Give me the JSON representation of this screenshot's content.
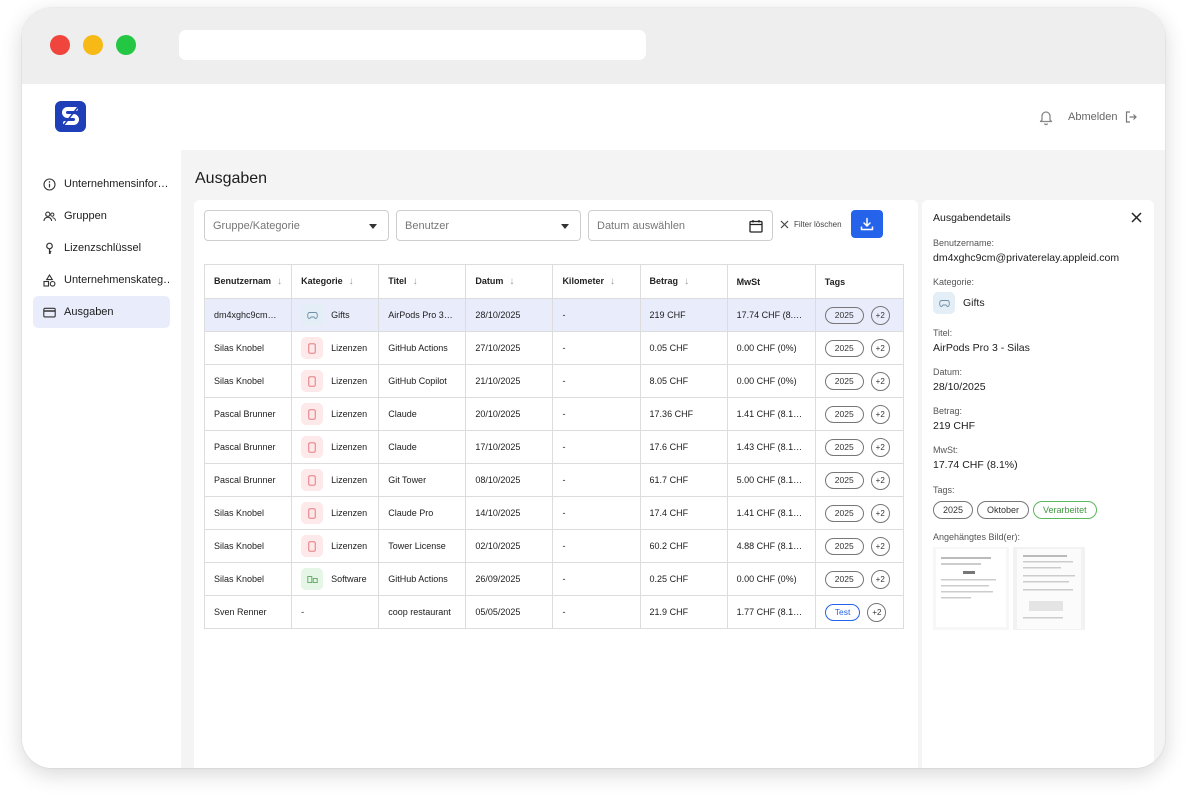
{
  "header": {
    "logout_label": "Abmelden"
  },
  "sidebar": {
    "items": [
      {
        "label": "Unternehmensinfor…",
        "icon": "info-icon"
      },
      {
        "label": "Gruppen",
        "icon": "users-icon"
      },
      {
        "label": "Lizenzschlüssel",
        "icon": "key-icon"
      },
      {
        "label": "Unternehmenskateg…",
        "icon": "shapes-icon"
      },
      {
        "label": "Ausgaben",
        "icon": "card-icon",
        "active": true
      }
    ]
  },
  "main": {
    "title": "Ausgaben",
    "filters": {
      "group_placeholder": "Gruppe/Kategorie",
      "user_placeholder": "Benutzer",
      "date_placeholder": "Datum auswählen",
      "clear_label": "Filter löschen"
    },
    "table": {
      "columns": [
        "Benutzernam",
        "Kategorie",
        "Titel",
        "Datum",
        "Kilometer",
        "Betrag",
        "MwSt",
        "Tags"
      ],
      "rows": [
        {
          "user": "dm4xghc9cm…",
          "category": "Gifts",
          "cat_type": "gifts",
          "title": "AirPods Pro 3…",
          "date": "28/10/2025",
          "km": "-",
          "amount": "219 CHF",
          "vat": "17.74 CHF (8.…",
          "tag": "2025",
          "more": "+2",
          "selected": true
        },
        {
          "user": "Silas Knobel",
          "category": "Lizenzen",
          "cat_type": "lic",
          "title": "GitHub Actions",
          "date": "27/10/2025",
          "km": "-",
          "amount": "0.05 CHF",
          "vat": "0.00 CHF (0%)",
          "tag": "2025",
          "more": "+2"
        },
        {
          "user": "Silas Knobel",
          "category": "Lizenzen",
          "cat_type": "lic",
          "title": "GitHub Copilot",
          "date": "21/10/2025",
          "km": "-",
          "amount": "8.05 CHF",
          "vat": "0.00 CHF (0%)",
          "tag": "2025",
          "more": "+2"
        },
        {
          "user": "Pascal Brunner",
          "category": "Lizenzen",
          "cat_type": "lic",
          "title": "Claude",
          "date": "20/10/2025",
          "km": "-",
          "amount": "17.36 CHF",
          "vat": "1.41 CHF (8.1…",
          "tag": "2025",
          "more": "+2"
        },
        {
          "user": "Pascal Brunner",
          "category": "Lizenzen",
          "cat_type": "lic",
          "title": "Claude",
          "date": "17/10/2025",
          "km": "-",
          "amount": "17.6 CHF",
          "vat": "1.43 CHF (8.1…",
          "tag": "2025",
          "more": "+2"
        },
        {
          "user": "Pascal Brunner",
          "category": "Lizenzen",
          "cat_type": "lic",
          "title": "Git Tower",
          "date": "08/10/2025",
          "km": "-",
          "amount": "61.7 CHF",
          "vat": "5.00 CHF (8.1…",
          "tag": "2025",
          "more": "+2"
        },
        {
          "user": "Silas Knobel",
          "category": "Lizenzen",
          "cat_type": "lic",
          "title": "Claude Pro",
          "date": "14/10/2025",
          "km": "-",
          "amount": "17.4 CHF",
          "vat": "1.41 CHF (8.1…",
          "tag": "2025",
          "more": "+2"
        },
        {
          "user": "Silas Knobel",
          "category": "Lizenzen",
          "cat_type": "lic",
          "title": "Tower License",
          "date": "02/10/2025",
          "km": "-",
          "amount": "60.2 CHF",
          "vat": "4.88 CHF (8.1…",
          "tag": "2025",
          "more": "+2"
        },
        {
          "user": "Silas Knobel",
          "category": "Software",
          "cat_type": "soft",
          "title": "GitHub Actions",
          "date": "26/09/2025",
          "km": "-",
          "amount": "0.25 CHF",
          "vat": "0.00 CHF (0%)",
          "tag": "2025",
          "more": "+2"
        },
        {
          "user": "Sven Renner",
          "category": "-",
          "cat_type": "none",
          "title": "coop restaurant",
          "date": "05/05/2025",
          "km": "-",
          "amount": "21.9 CHF",
          "vat": "1.77 CHF (8.1…",
          "tag": "Test",
          "more": "+2",
          "tag_style": "test"
        }
      ]
    }
  },
  "details": {
    "title": "Ausgabendetails",
    "username_label": "Benutzername:",
    "username": "dm4xghc9cm@privaterelay.appleid.com",
    "category_label": "Kategorie:",
    "category": "Gifts",
    "title_label": "Titel:",
    "title_value": "AirPods Pro 3 - Silas",
    "date_label": "Datum:",
    "date": "28/10/2025",
    "amount_label": "Betrag:",
    "amount": "219 CHF",
    "vat_label": "MwSt:",
    "vat": "17.74 CHF (8.1%)",
    "tags_label": "Tags:",
    "tags": [
      "2025",
      "Oktober",
      "Verarbeitet"
    ],
    "attachment_label": "Angehängtes Bild(er):"
  },
  "colors": {
    "brand": "#1f3fb8",
    "accent": "#2563eb",
    "selected_row": "#e9ecfb",
    "processed_tag": "#5cb85c"
  }
}
